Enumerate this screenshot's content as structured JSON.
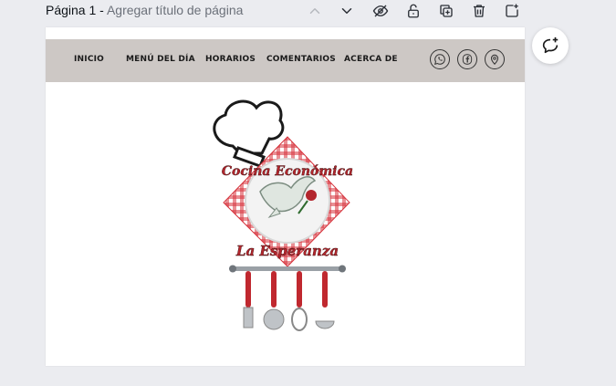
{
  "page_header": {
    "page_label": "Página 1",
    "separator": " - ",
    "title_placeholder": "Agregar título de página"
  },
  "toolbar": {
    "icons": [
      "chevron-up-icon",
      "chevron-down-icon",
      "hide-page-icon",
      "lock-icon",
      "duplicate-page-icon",
      "delete-icon",
      "add-page-icon"
    ]
  },
  "navbar": {
    "items": [
      {
        "label": "INICIO"
      },
      {
        "label": "MENÚ DEL DÍA"
      },
      {
        "label": "HORARIOS"
      },
      {
        "label": "COMENTARIOS"
      },
      {
        "label": "ACERCA DE"
      }
    ],
    "social_icons": [
      "whatsapp-icon",
      "facebook-icon",
      "location-icon"
    ]
  },
  "logo": {
    "line1": "Cocina Económica",
    "line2": "La Esperanza"
  },
  "colors": {
    "workspace_bg": "#ebecf0",
    "navbar_bg": "#cdc8c5",
    "logo_red": "#b3262d",
    "gingham_red": "#d6333c"
  }
}
